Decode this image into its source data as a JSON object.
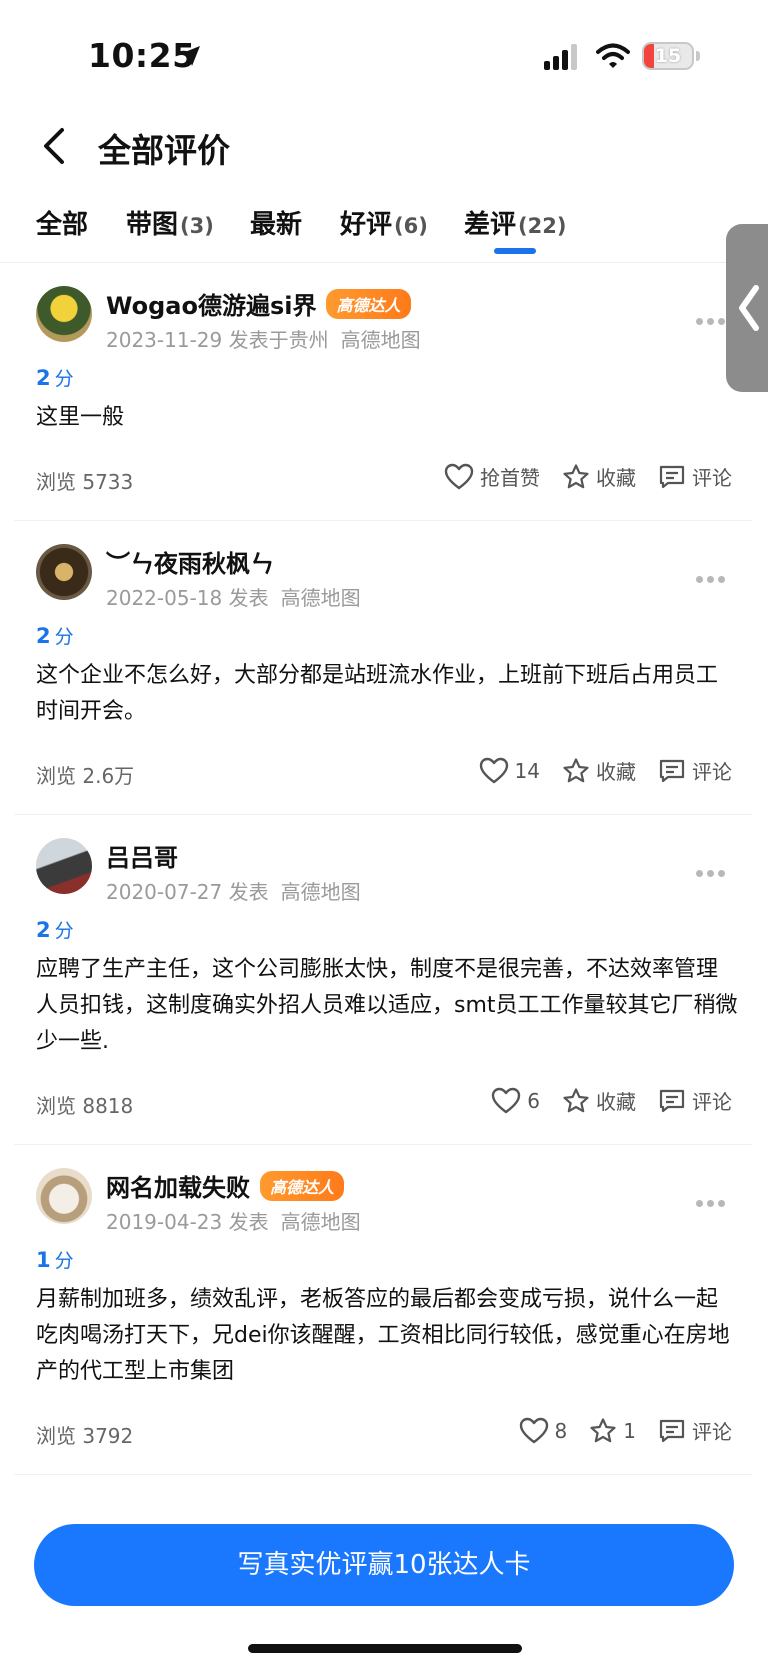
{
  "status_bar": {
    "time": "10:25",
    "battery": "15"
  },
  "header": {
    "title": "全部评价"
  },
  "tabs": [
    {
      "label": "全部",
      "count": ""
    },
    {
      "label": "带图",
      "count": "(3)"
    },
    {
      "label": "最新",
      "count": ""
    },
    {
      "label": "好评",
      "count": "(6)"
    },
    {
      "label": "差评",
      "count": "(22)"
    }
  ],
  "active_tab": "差评",
  "reviews": [
    {
      "name": "Wogao德游遍si界",
      "badge": "高德达人",
      "date": "2023-11-29 发表于贵州",
      "source": "高德地图",
      "score": "2",
      "score_unit": "分",
      "text": "这里一般",
      "views": "浏览 5733",
      "like": "抢首赞",
      "fav": "收藏",
      "comment": "评论"
    },
    {
      "name": "︶ㄣ夜雨秋枫ㄣ",
      "badge": "",
      "date": "2022-05-18 发表",
      "source": "高德地图",
      "score": "2",
      "score_unit": "分",
      "text": "这个企业不怎么好，大部分都是站班流水作业，上班前下班后占用员工时间开会。",
      "views": "浏览 2.6万",
      "like": "14",
      "fav": "收藏",
      "comment": "评论"
    },
    {
      "name": "吕吕哥",
      "badge": "",
      "date": "2020-07-27 发表",
      "source": "高德地图",
      "score": "2",
      "score_unit": "分",
      "text": "应聘了生产主任，这个公司膨胀太快，制度不是很完善，不达效率管理人员扣钱，这制度确实外招人员难以适应，smt员工工作量较其它厂稍微少一些.",
      "views": "浏览 8818",
      "like": "6",
      "fav": "收藏",
      "comment": "评论"
    },
    {
      "name": "网名加载失败",
      "badge": "高德达人",
      "date": "2019-04-23 发表",
      "source": "高德地图",
      "score": "1",
      "score_unit": "分",
      "text": "月薪制加班多，绩效乱评，老板答应的最后都会变成亏损，说什么一起吃肉喝汤打天下，兄dei你该醒醒，工资相比同行较低，感觉重心在房地产的代工型上市集团",
      "views": "浏览 3792",
      "like": "8",
      "fav": "1",
      "comment": "评论"
    }
  ],
  "cta": {
    "label": "写真实优评赢10张达人卡"
  },
  "colors": {
    "accent": "#1a73e8",
    "badge": "#ff8a1f",
    "cta": "#1a78ff"
  },
  "icons": [
    "location-arrow-icon",
    "signal-icon",
    "wifi-icon",
    "battery-icon",
    "back-chevron-icon",
    "heart-icon",
    "star-icon",
    "comment-icon",
    "more-dots-icon",
    "side-chevron-icon"
  ]
}
